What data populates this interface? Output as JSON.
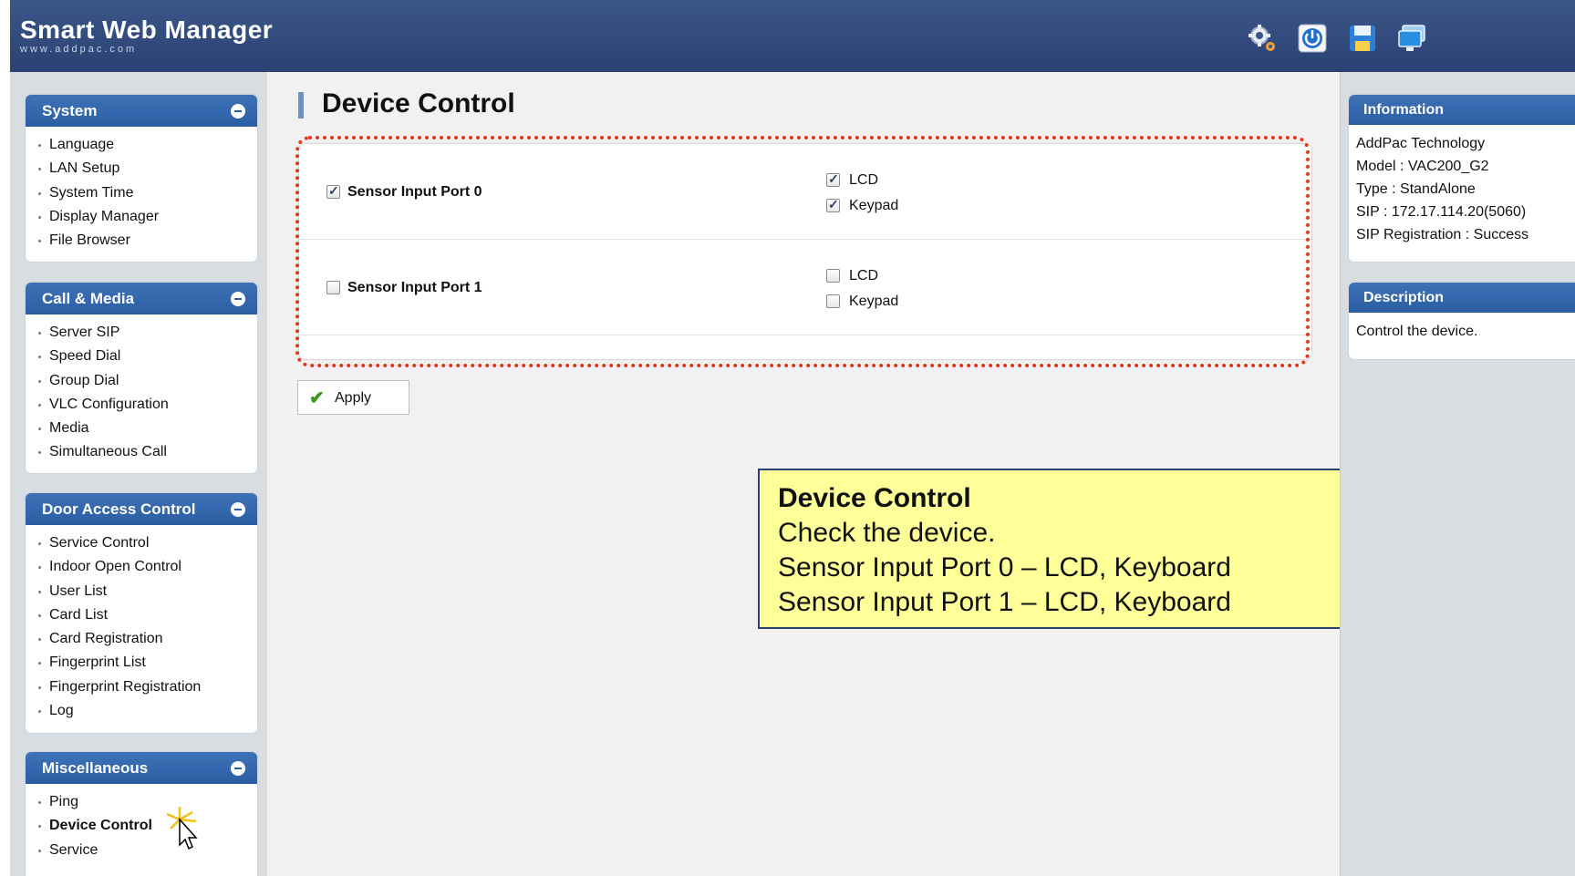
{
  "app": {
    "title": "Smart Web Manager",
    "subtitle": "www.addpac.com"
  },
  "header_icons": [
    "settings-gear-icon",
    "power-icon",
    "save-disk-icon",
    "monitor-icon"
  ],
  "sidebar": {
    "sections": [
      {
        "title": "System",
        "items": [
          "Language",
          "LAN Setup",
          "System Time",
          "Display Manager",
          "File Browser"
        ]
      },
      {
        "title": "Call & Media",
        "items": [
          "Server SIP",
          "Speed Dial",
          "Group Dial",
          "VLC Configuration",
          "Media",
          "Simultaneous Call"
        ]
      },
      {
        "title": "Door Access Control",
        "items": [
          "Service Control",
          "Indoor Open Control",
          "User List",
          "Card List",
          "Card Registration",
          "Fingerprint List",
          "Fingerprint Registration",
          "Log"
        ]
      },
      {
        "title": "Miscellaneous",
        "items": [
          "Ping",
          "Device Control",
          "Service"
        ]
      }
    ],
    "active_item": "Device Control"
  },
  "main": {
    "title": "Device Control",
    "ports": [
      {
        "label": "Sensor Input Port 0",
        "checked": true,
        "options": [
          {
            "label": "LCD",
            "checked": true
          },
          {
            "label": "Keypad",
            "checked": true
          }
        ]
      },
      {
        "label": "Sensor Input Port 1",
        "checked": false,
        "options": [
          {
            "label": "LCD",
            "checked": false
          },
          {
            "label": "Keypad",
            "checked": false
          }
        ]
      }
    ],
    "apply_label": "Apply"
  },
  "note": {
    "title": "Device Control",
    "lines": [
      "Check the device.",
      "Sensor Input Port 0 – LCD, Keyboard",
      "Sensor Input Port 1 – LCD, Keyboard"
    ]
  },
  "right": {
    "information": {
      "title": "Information",
      "lines": [
        "AddPac Technology",
        "Model : VAC200_G2",
        "Type : StandAlone",
        "SIP : 172.17.114.20(5060)",
        "SIP Registration : Success"
      ]
    },
    "description": {
      "title": "Description",
      "text": "Control the device."
    }
  },
  "colors": {
    "header": "#2b4272",
    "section_header": "#2b5da3",
    "highlight_border": "#e8361c",
    "note_background": "#ffff99"
  }
}
